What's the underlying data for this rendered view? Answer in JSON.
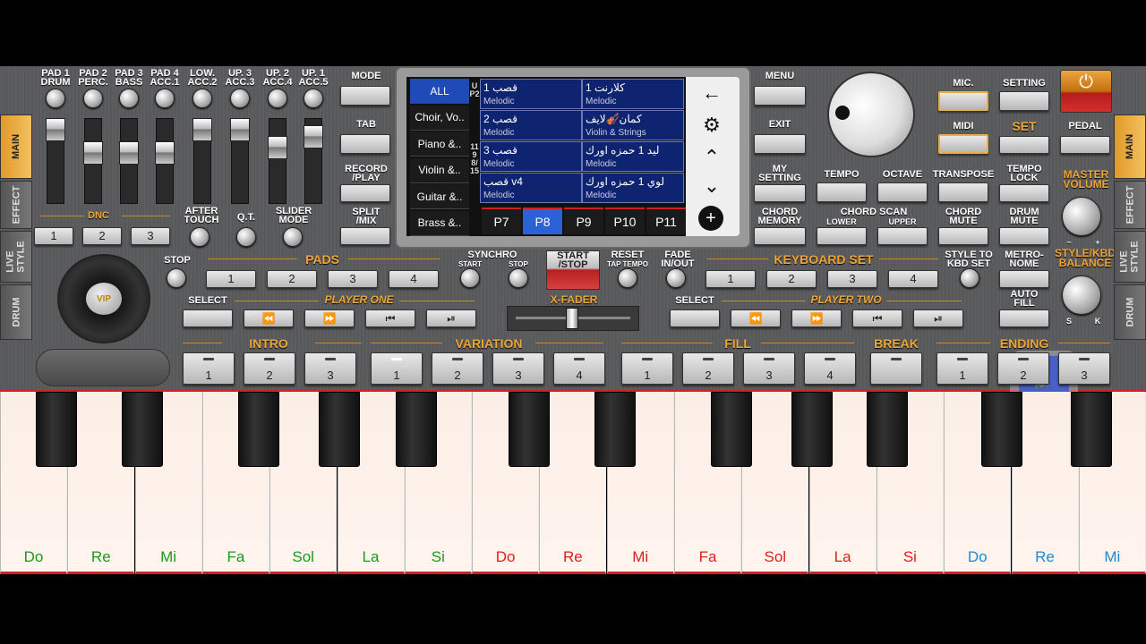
{
  "pads_top": [
    "PAD 1\nDRUM",
    "PAD 2\nPERC.",
    "PAD 3\nBASS",
    "PAD 4\nACC.1",
    "LOW.\nACC.2",
    "UP. 3\nACC.3",
    "UP. 2\nACC.4",
    "UP. 1\nACC.5"
  ],
  "left": {
    "dnc": "DNC",
    "dnc_buttons": [
      "1",
      "2",
      "3"
    ],
    "after_touch": "AFTER\nTOUCH",
    "qt": "Q.T.",
    "slider_mode": "SLIDER\nMODE",
    "stop": "STOP",
    "vip": "VIP"
  },
  "side_left": [
    "MAIN",
    "EFFECT",
    "LIVE\nSTYLE",
    "DRUM"
  ],
  "side_right": [
    "MAIN",
    "EFFECT",
    "LIVE\nSTYLE",
    "DRUM"
  ],
  "mid_left": {
    "mode": "MODE",
    "tab": "TAB",
    "record": "RECORD\n/PLAY",
    "split": "SPLIT\n/MIX"
  },
  "mid_right": {
    "menu": "MENU",
    "exit": "EXIT",
    "my_setting": "MY\nSETTING",
    "chord_memory": "CHORD\nMEMORY"
  },
  "screen": {
    "categories": [
      "ALL",
      "Choir, Vo..",
      "Piano &..",
      "Violin &..",
      "Guitar &..",
      "Brass &.."
    ],
    "upper_label": "UP2",
    "page_label": "119\n8/15",
    "cells": [
      {
        "title": "قصب 1",
        "sub": "Melodic"
      },
      {
        "title": "كلارنت 1",
        "sub": "Melodic"
      },
      {
        "title": "قصب 2",
        "sub": "Melodic"
      },
      {
        "title": "كمان🎻لايف",
        "sub": "Violin & Strings"
      },
      {
        "title": "قصب 3",
        "sub": "Melodic"
      },
      {
        "title": "ليد 1 حمزه اورك",
        "sub": "Melodic"
      },
      {
        "title": "قصب v4",
        "sub": "Melodic"
      },
      {
        "title": "لوي 1 حمزه اورك",
        "sub": "Melodic"
      }
    ],
    "pages": [
      "P7",
      "P8",
      "P9",
      "P10",
      "P11"
    ],
    "active_page": "P8"
  },
  "right": {
    "mic": "MIC.",
    "setting": "SETTING",
    "midi": "MIDI",
    "set": "SET",
    "pedal": "PEDAL",
    "tempo": "TEMPO",
    "octave": "OCTAVE",
    "transpose": "TRANSPOSE",
    "tempo_lock": "TEMPO\nLOCK",
    "master_volume": "MASTER\nVOLUME",
    "chord_scan": "CHORD SCAN",
    "lower": "LOWER",
    "upper": "UPPER",
    "chord_mute": "CHORD\nMUTE",
    "drum_mute": "DRUM\nMUTE",
    "style_balance": "STYLE/KBD\nBALANCE",
    "s": "S",
    "k": "K",
    "minus": "−",
    "plus": "+",
    "style_to_kbd": "STYLE TO\nKBD SET",
    "metronome": "METRO-\nNOME",
    "auto_fill": "AUTO\nFILL"
  },
  "pads_row": {
    "pads": "PADS",
    "buttons": [
      "1",
      "2",
      "3",
      "4"
    ],
    "synchro": "SYNCHRO",
    "start": "START",
    "stop": "STOP",
    "start_stop": "START\n/STOP",
    "reset": "RESET",
    "tap_tempo": "TAP TEMPO",
    "fade": "FADE\nIN/OUT",
    "keyboard_set": "KEYBOARD SET",
    "kbd_buttons": [
      "1",
      "2",
      "3",
      "4"
    ]
  },
  "players": {
    "select": "SELECT",
    "player_one": "PLAYER ONE",
    "player_two": "PLAYER TWO",
    "xfader": "X-FADER"
  },
  "sections": {
    "intro": "INTRO",
    "variation": "VARIATION",
    "fill": "FILL",
    "break": "BREAK",
    "ending": "ENDING",
    "intro_btns": [
      "1",
      "2",
      "3"
    ],
    "var_btns": [
      "1",
      "2",
      "3",
      "4"
    ],
    "fill_btns": [
      "1",
      "2",
      "3",
      "4"
    ],
    "end_btns": [
      "1",
      "2",
      "3"
    ]
  },
  "keys": [
    {
      "n": "Do",
      "c": "#1a9a1a"
    },
    {
      "n": "Re",
      "c": "#1a9a1a"
    },
    {
      "n": "Mi",
      "c": "#1a9a1a"
    },
    {
      "n": "Fa",
      "c": "#1a9a1a"
    },
    {
      "n": "Sol",
      "c": "#1a9a1a"
    },
    {
      "n": "La",
      "c": "#1a9a1a"
    },
    {
      "n": "Si",
      "c": "#1a9a1a"
    },
    {
      "n": "Do",
      "c": "#e0201a"
    },
    {
      "n": "Re",
      "c": "#e0201a"
    },
    {
      "n": "Mi",
      "c": "#e0201a"
    },
    {
      "n": "Fa",
      "c": "#e0201a"
    },
    {
      "n": "Sol",
      "c": "#e0201a"
    },
    {
      "n": "La",
      "c": "#e0201a"
    },
    {
      "n": "Si",
      "c": "#e0201a"
    },
    {
      "n": "Do",
      "c": "#1a8ad6"
    },
    {
      "n": "Re",
      "c": "#1a8ad6"
    },
    {
      "n": "Mi",
      "c": "#1a8ad6"
    }
  ]
}
